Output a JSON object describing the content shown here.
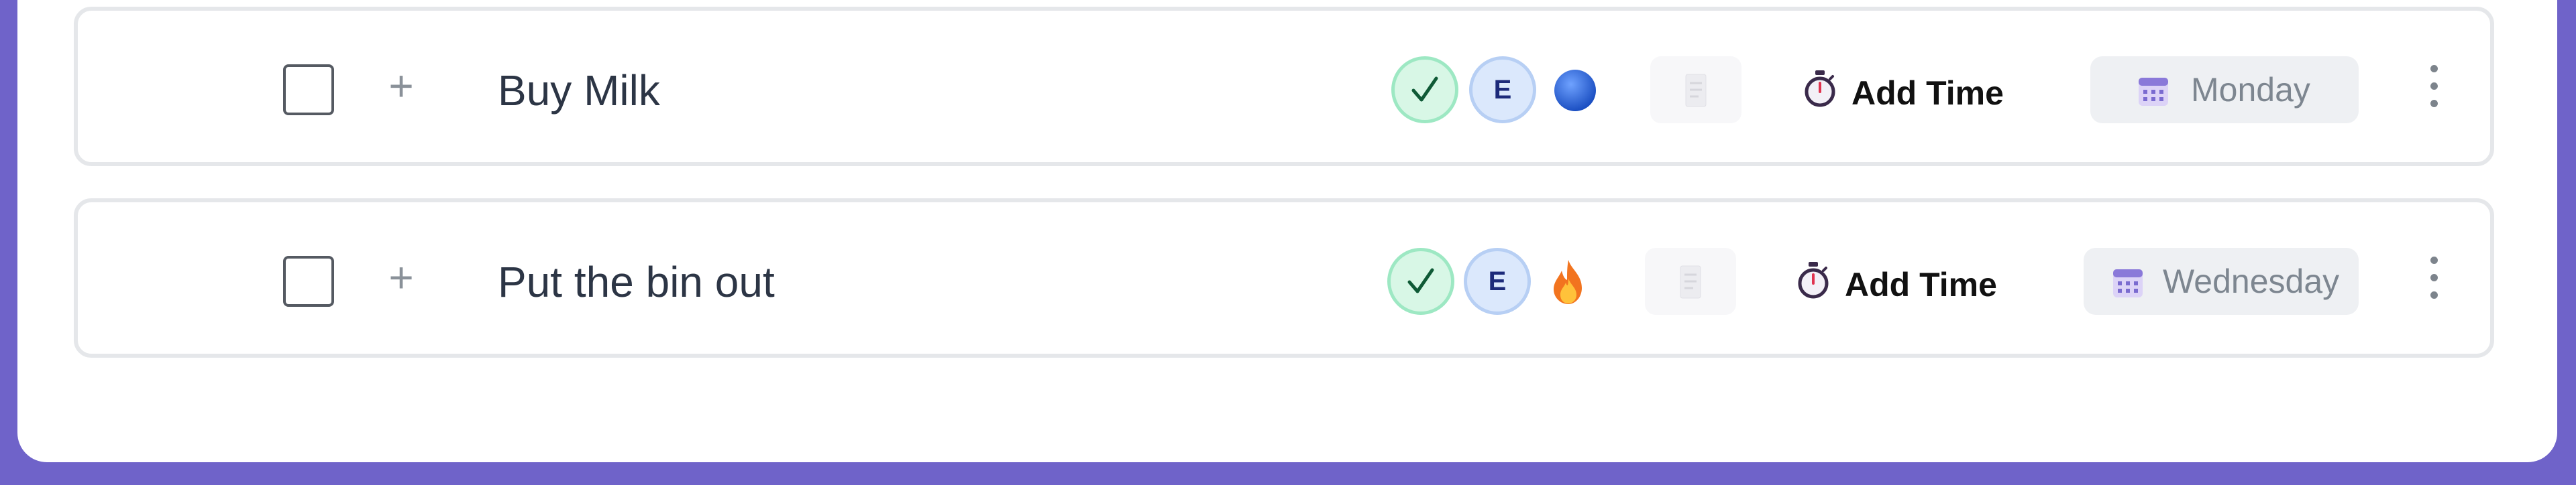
{
  "tasks": [
    {
      "title": "Buy Milk",
      "assignee_initial": "E",
      "priority_icon": "blue-circle-icon",
      "add_time_label": "Add Time",
      "due_day": "Monday"
    },
    {
      "title": "Put the bin out",
      "assignee_initial": "E",
      "priority_icon": "fire-icon",
      "add_time_label": "Add Time",
      "due_day": "Wednesday"
    }
  ],
  "icons": {
    "complete": "checkmark-icon",
    "add_subtask": "plus-icon",
    "note": "document-icon",
    "timer": "stopwatch-icon",
    "calendar": "calendar-icon",
    "menu": "kebab-menu-icon"
  },
  "colors": {
    "background": "#6f63c9",
    "check_fill": "#d8f7e6",
    "avatar_fill": "#dbe8fc",
    "day_pill": "#eef0f3"
  }
}
